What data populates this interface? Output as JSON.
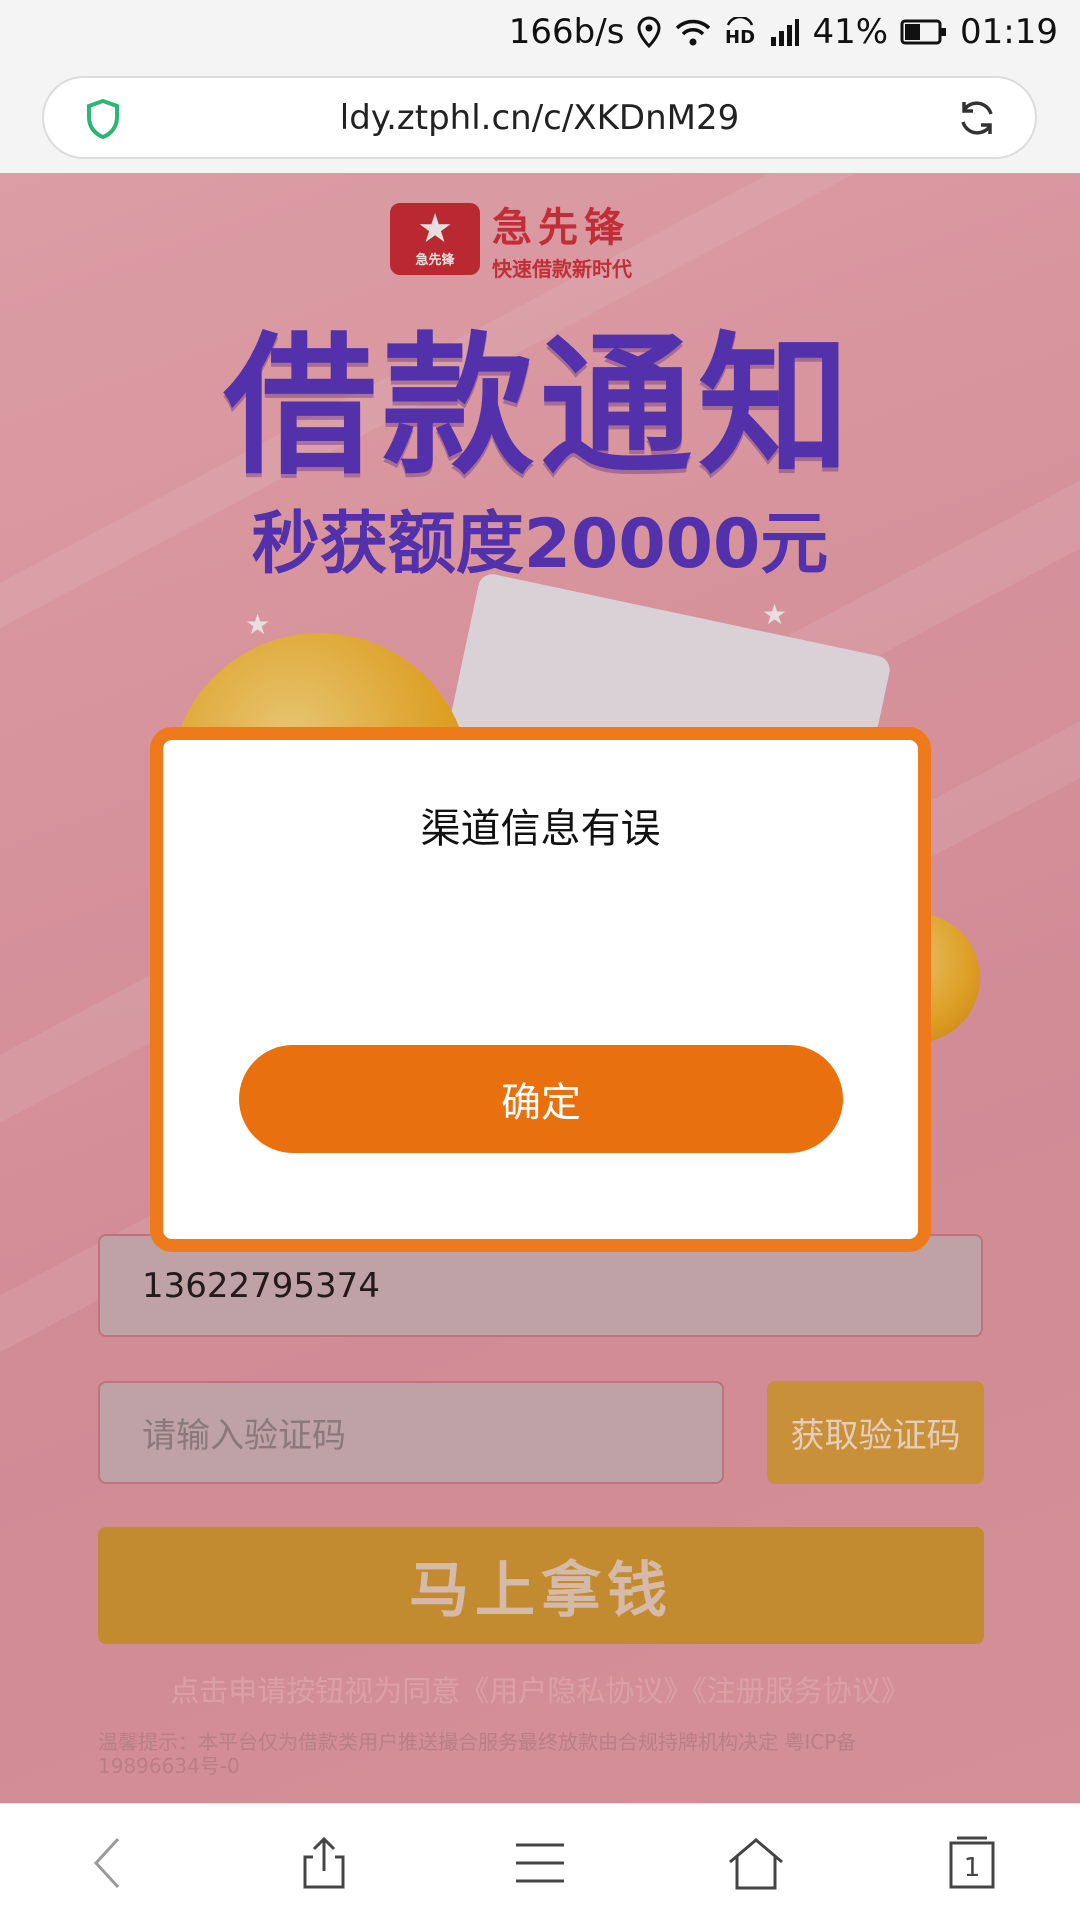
{
  "status_bar": {
    "net_speed": "166b/s",
    "battery": "41%",
    "time": "01:19",
    "icons": [
      "location-icon",
      "wifi-icon",
      "hd-icon",
      "signal-icon",
      "battery-icon"
    ]
  },
  "browser": {
    "url": "ldy.ztphl.cn/c/XKDnM29",
    "icons": [
      "shield-icon",
      "reload-icon"
    ]
  },
  "page": {
    "brand_name": "急先锋",
    "brand_logo_text": "急先锋",
    "brand_slogan": "快速借款新时代",
    "hero_title": "借款通知",
    "hero_subtitle": "秒获额度20000元",
    "phone_value": "13622795374",
    "code_placeholder": "请输入验证码",
    "get_code_label": "获取验证码",
    "get_money_label": "马上拿钱",
    "agreement_text": "点击申请按钮视为同意《用户隐私协议》《注册服务协议》",
    "tip_text": "温馨提示：本平台仅为借款类用户推送撮合服务最终放款由合规持牌机构决定 粤ICP备19896634号-0"
  },
  "dialog": {
    "title": "渠道信息有误",
    "confirm_label": "确定"
  },
  "bottom_nav": {
    "tab_count": "1",
    "icons": [
      "back-icon",
      "share-icon",
      "menu-icon",
      "home-icon",
      "tabs-icon"
    ]
  },
  "colors": {
    "accent_orange": "#e8700f",
    "title_purple": "#4a2cc0",
    "brand_red": "#c8232b"
  }
}
